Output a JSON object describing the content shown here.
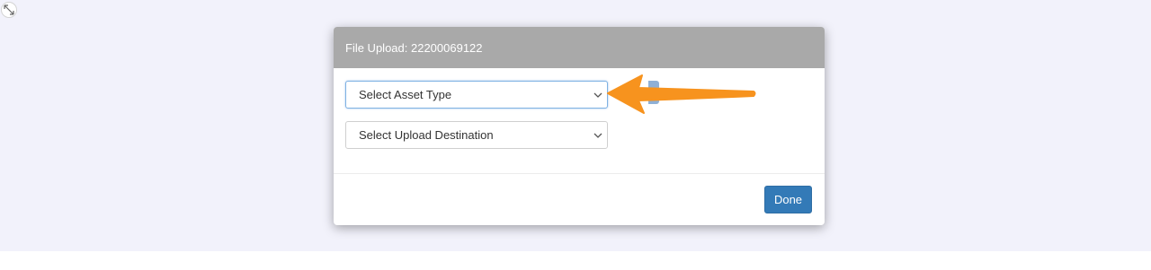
{
  "modal": {
    "title": "File Upload: 22200069122",
    "asset_type_select": {
      "value": "Select Asset Type"
    },
    "upload_destination_select": {
      "value": "Select Upload Destination"
    },
    "done_label": "Done"
  },
  "icons": {
    "expand": "expand-arrows-icon",
    "chevron": "chevron-down-icon",
    "pointer": "arrow-pointer-icon"
  },
  "colors": {
    "header_bg": "#a9a9a9",
    "primary_button": "#337ab7",
    "annotation_arrow": "#f7931e",
    "page_bg": "#f2f2fb"
  }
}
